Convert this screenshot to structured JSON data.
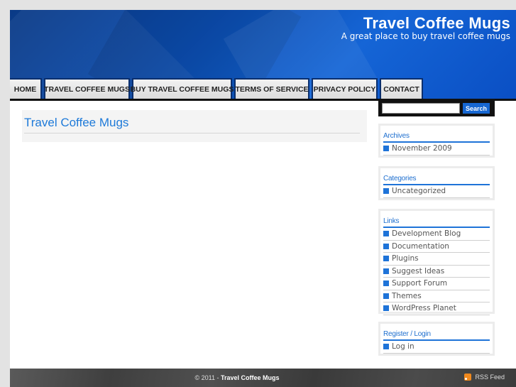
{
  "header": {
    "title": "Travel Coffee Mugs",
    "tagline": "A great place to buy travel coffee mugs"
  },
  "nav": [
    {
      "label": "HOME"
    },
    {
      "label": "TRAVEL COFFEE MUGS"
    },
    {
      "label": "BUY TRAVEL COFFEE MUGS"
    },
    {
      "label": "TERMS OF SERVICE"
    },
    {
      "label": "PRIVACY POLICY"
    },
    {
      "label": "CONTACT"
    }
  ],
  "main": {
    "post_title": "Travel Coffee Mugs"
  },
  "search": {
    "value": "",
    "button_label": "Search"
  },
  "widgets": {
    "archives": {
      "title": "Archives",
      "items": [
        "November 2009"
      ]
    },
    "categories": {
      "title": "Categories",
      "items": [
        "Uncategorized"
      ]
    },
    "links": {
      "title": "Links",
      "items": [
        "Development Blog",
        "Documentation",
        "Plugins",
        "Suggest Ideas",
        "Support Forum",
        "Themes",
        "WordPress Planet"
      ]
    },
    "register": {
      "title": "Register / Login",
      "items": [
        "Log in"
      ]
    }
  },
  "footer": {
    "copyright": "© 2011 - ",
    "site_name": "Travel Coffee Mugs",
    "rss_label": "RSS Feed"
  },
  "colors": {
    "accent": "#1e73d8",
    "header_blue": "#0b4cae",
    "footer_gray": "#444444"
  }
}
